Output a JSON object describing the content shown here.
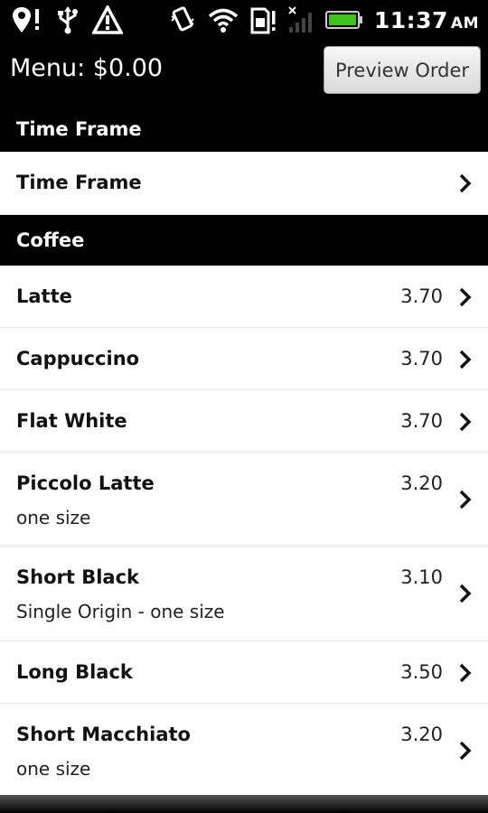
{
  "status_bar": {
    "time": "11:37",
    "ampm": "AM",
    "icons_left": [
      "location-alert-icon",
      "usb-icon",
      "warning-icon"
    ],
    "icons_right": [
      "vibrate-icon",
      "wifi-icon",
      "sim-alert-icon",
      "signal-icon",
      "battery-icon"
    ]
  },
  "header": {
    "title": "Menu: $0.00",
    "preview_button": "Preview Order"
  },
  "sections": [
    {
      "title": "Time Frame"
    },
    {
      "title": "Coffee"
    }
  ],
  "time_frame_row": {
    "name": "Time Frame"
  },
  "coffee_items": [
    {
      "name": "Latte",
      "price": "3.70",
      "sub": ""
    },
    {
      "name": "Cappuccino",
      "price": "3.70",
      "sub": ""
    },
    {
      "name": "Flat White",
      "price": "3.70",
      "sub": ""
    },
    {
      "name": "Piccolo Latte",
      "price": "3.20",
      "sub": "one size"
    },
    {
      "name": "Short Black",
      "price": "3.10",
      "sub": "Single Origin - one size"
    },
    {
      "name": "Long Black",
      "price": "3.50",
      "sub": ""
    },
    {
      "name": "Short Macchiato",
      "price": "3.20",
      "sub": "one size"
    }
  ]
}
